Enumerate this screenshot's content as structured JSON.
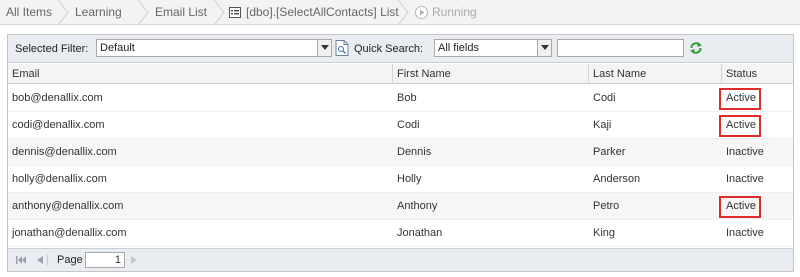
{
  "breadcrumb": {
    "items": [
      "All Items",
      "Learning",
      "Email List",
      "[dbo].[SelectAllContacts] List",
      "Running"
    ]
  },
  "toolbar": {
    "filter_label": "Selected Filter:",
    "filter_value": "Default",
    "quick_search_label": "Quick Search:",
    "search_field_value": "All fields",
    "search_text": ""
  },
  "table": {
    "columns": [
      "Email",
      "First Name",
      "Last Name",
      "Status"
    ],
    "rows": [
      {
        "email": "bob@denallix.com",
        "first": "Bob",
        "last": "Codi",
        "status": "Active",
        "highlighted": true
      },
      {
        "email": "codi@denallix.com",
        "first": "Codi",
        "last": "Kaji",
        "status": "Active",
        "highlighted": true
      },
      {
        "email": "dennis@denallix.com",
        "first": "Dennis",
        "last": "Parker",
        "status": "Inactive",
        "highlighted": false
      },
      {
        "email": "holly@denallix.com",
        "first": "Holly",
        "last": "Anderson",
        "status": "Inactive",
        "highlighted": false
      },
      {
        "email": "anthony@denallix.com",
        "first": "Anthony",
        "last": "Petro",
        "status": "Active",
        "highlighted": true
      },
      {
        "email": "jonathan@denallix.com",
        "first": "Jonathan",
        "last": "King",
        "status": "Inactive",
        "highlighted": false
      }
    ]
  },
  "pager": {
    "page_label": "Page",
    "page_value": "1"
  },
  "colors": {
    "highlight": "#e02b2b",
    "refresh": "#3a9a3a"
  }
}
